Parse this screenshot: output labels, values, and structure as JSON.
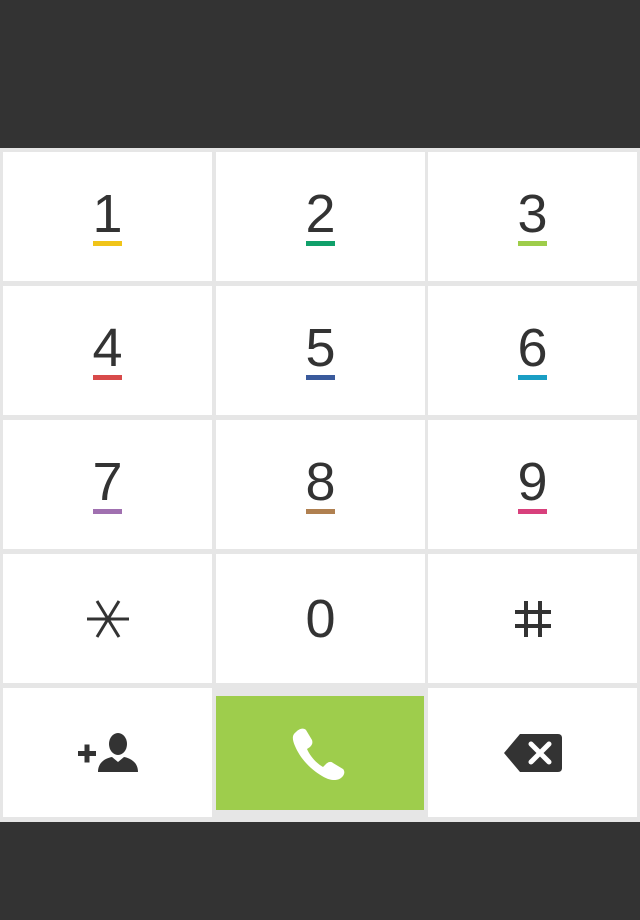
{
  "keys": [
    {
      "digit": "1",
      "color": "#f0c419"
    },
    {
      "digit": "2",
      "color": "#10a06a"
    },
    {
      "digit": "3",
      "color": "#9ecd4a"
    },
    {
      "digit": "4",
      "color": "#d84a4a"
    },
    {
      "digit": "5",
      "color": "#3a5a9c"
    },
    {
      "digit": "6",
      "color": "#1a9ec4"
    },
    {
      "digit": "7",
      "color": "#a070b0"
    },
    {
      "digit": "8",
      "color": "#b08050"
    },
    {
      "digit": "9",
      "color": "#d8407c"
    },
    {
      "digit": "*"
    },
    {
      "digit": "0"
    },
    {
      "digit": "#"
    }
  ],
  "actions": {
    "add_contact_icon": "add-contact-icon",
    "call_icon": "phone-icon",
    "backspace_icon": "backspace-icon",
    "call_color": "#9ecd4c"
  },
  "colors": {
    "background": "#333333",
    "key_bg": "#ffffff",
    "grid": "#e6e6e6",
    "text": "#333333"
  }
}
